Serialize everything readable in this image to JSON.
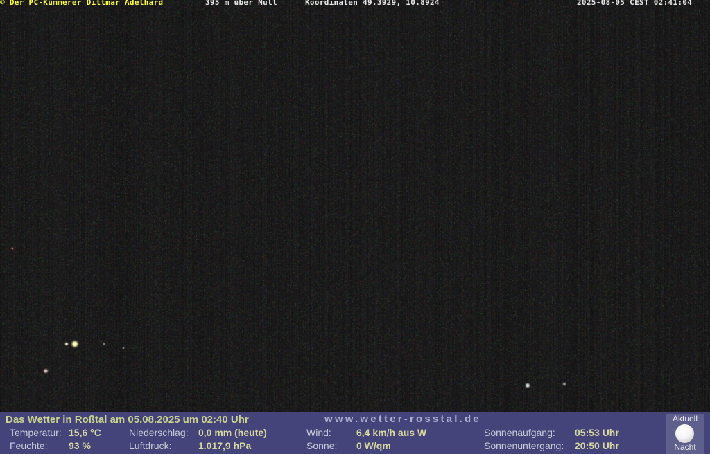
{
  "overlay": {
    "copyright": "© Der PC-Kümmerer Dittmar Adelhard",
    "altitude": "395 m über Null",
    "coordinates": "Koordinaten 49.3929, 10.8924",
    "timestamp": "2025-08-05 CEST 02:41:04"
  },
  "weather": {
    "heading": "Das Wetter in Roßtal am 05.08.2025 um 02:40 Uhr",
    "website": "www.wetter-rosstal.de",
    "temperature": {
      "label": "Temperatur:",
      "value": "15,6 °C"
    },
    "humidity": {
      "label": "Feuchte:",
      "value": "93 %"
    },
    "precipitation": {
      "label": "Niederschlag:",
      "value": "0,0 mm (heute)"
    },
    "pressure": {
      "label": "Luftdruck:",
      "value": "1.017,9 hPa"
    },
    "wind": {
      "label": "Wind:",
      "value": "6,4 km/h aus W"
    },
    "sun": {
      "label": "Sonne:",
      "value": "0 W/qm"
    },
    "sunrise": {
      "label": "Sonnenaufgang:",
      "value": "05:53 Uhr"
    },
    "sunset": {
      "label": "Sonnenuntergang:",
      "value": "20:50 Uhr"
    }
  },
  "moon": {
    "top_label": "Aktuell",
    "bottom_label": "Nacht",
    "icon": "full-moon-icon"
  },
  "colors": {
    "overlay_yellow": "#ffff40",
    "infobar_bg": "#45447a",
    "value_text": "#d6d9a0"
  }
}
